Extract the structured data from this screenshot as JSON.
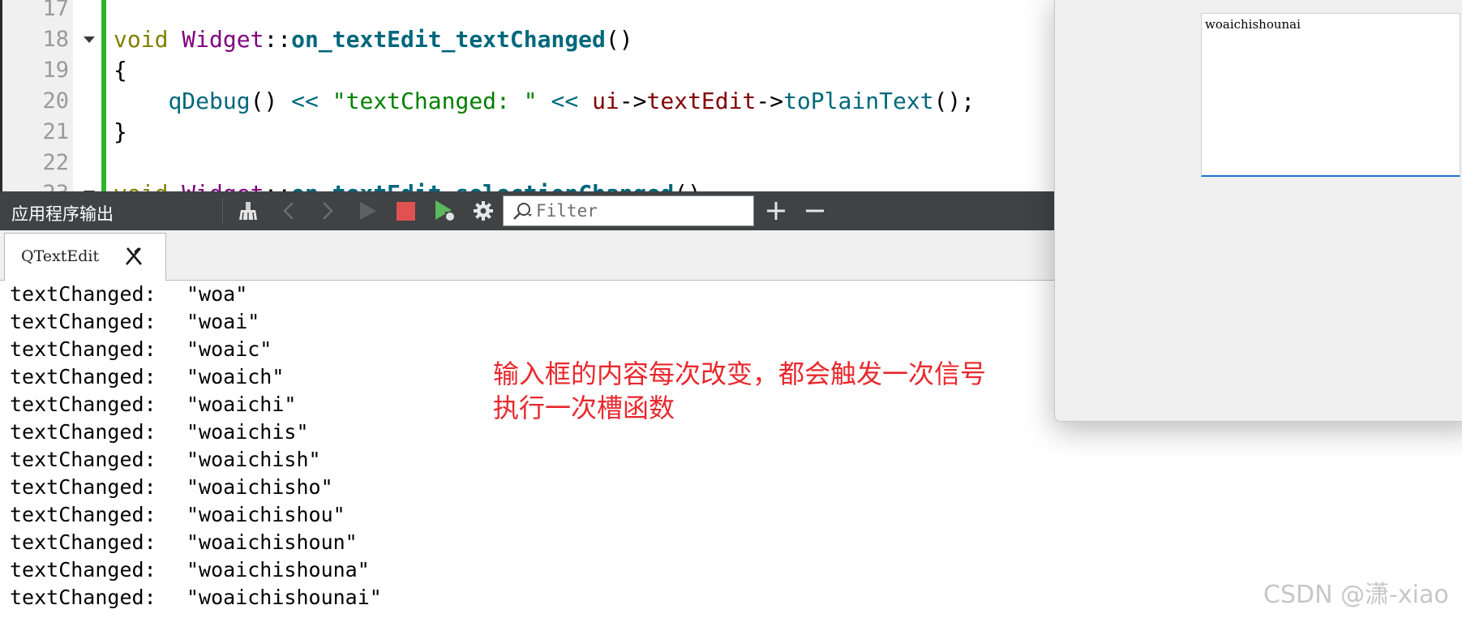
{
  "editor": {
    "line_numbers": [
      "17",
      "18",
      "19",
      "20",
      "21",
      "22",
      "23"
    ],
    "code": {
      "l18_kw": "void",
      "l18_cls": "Widget",
      "l18_sep": "::",
      "l18_fn": "on_textEdit_textChanged",
      "l18_paren": "()",
      "l19": "{",
      "l20_indent": "    ",
      "l20_fn": "qDebug",
      "l20_a": "() ",
      "l20_op1": "<<",
      "l20_b": " ",
      "l20_str": "\"textChanged: \"",
      "l20_c": " ",
      "l20_op2": "<<",
      "l20_d": " ",
      "l20_ui": "ui",
      "l20_arrow1": "->",
      "l20_mem": "textEdit",
      "l20_arrow2": "->",
      "l20_fn2": "toPlainText",
      "l20_end": "();",
      "l21": "}",
      "l23_kw": "void",
      "l23_cls": "Widget",
      "l23_sep": "::",
      "l23_fn": "on_textEdit_selectionChanged",
      "l23_paren": "()"
    }
  },
  "output_pane": {
    "title": "应用程序输出",
    "filter_placeholder": "Filter",
    "tab_label": "QTextEdit",
    "colors": {
      "toolbar_bg": "#404244",
      "stop": "#e05252",
      "run": "#5cb85c"
    }
  },
  "output_lines": [
    {
      "key": "textChanged:",
      "value": "\"woa\""
    },
    {
      "key": "textChanged:",
      "value": "\"woai\""
    },
    {
      "key": "textChanged:",
      "value": "\"woaic\""
    },
    {
      "key": "textChanged:",
      "value": "\"woaich\""
    },
    {
      "key": "textChanged:",
      "value": "\"woaichi\""
    },
    {
      "key": "textChanged:",
      "value": "\"woaichis\""
    },
    {
      "key": "textChanged:",
      "value": "\"woaichish\""
    },
    {
      "key": "textChanged:",
      "value": "\"woaichisho\""
    },
    {
      "key": "textChanged:",
      "value": "\"woaichishou\""
    },
    {
      "key": "textChanged:",
      "value": "\"woaichishoun\""
    },
    {
      "key": "textChanged:",
      "value": "\"woaichishouna\""
    },
    {
      "key": "textChanged:",
      "value": "\"woaichishounai\""
    }
  ],
  "annotation": {
    "line1": "输入框的内容每次改变，都会触发一次信号",
    "line2": "执行一次槽函数",
    "color": "#e8282d"
  },
  "app_window": {
    "textedit_value": "woaichishounai"
  },
  "watermark": "CSDN @潇-xiao"
}
